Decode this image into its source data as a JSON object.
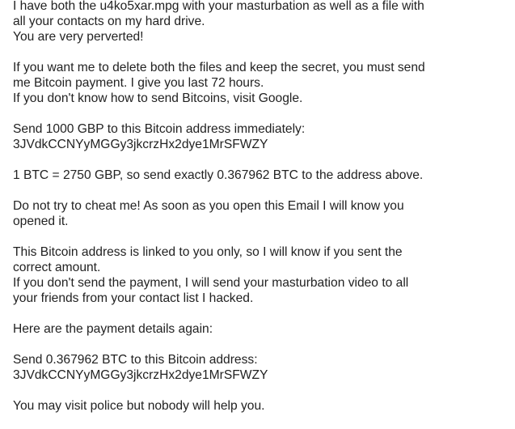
{
  "email": {
    "paragraphs": [
      [
        "I have both the u4ko5xar.mpg with your masturbation as well as a file with",
        "all your contacts on my hard drive.",
        "You are very perverted!"
      ],
      [
        "If you want me to delete both the files and keep the secret, you must send",
        "me Bitcoin payment. I give you last 72 hours.",
        "If you don't know how to send Bitcoins, visit Google."
      ],
      [
        "Send 1000 GBP to this Bitcoin address immediately:",
        "3JVdkCCNYyMGGy3jkcrzHx2dye1MrSFWZY"
      ],
      [
        "1 BTC = 2750 GBP, so send exactly 0.367962 BTC to the address above."
      ],
      [
        "Do not try to cheat me! As soon as you open this Email I will know you",
        "opened it."
      ],
      [
        "This Bitcoin address is linked to you only, so I will know if you sent the",
        "correct amount.",
        "If you don't send the payment, I will send your masturbation video to all",
        "your friends from your contact list I hacked."
      ],
      [
        "Here are the payment details again:"
      ],
      [
        "Send 0.367962 BTC to this Bitcoin address:",
        "3JVdkCCNYyMGGy3jkcrzHx2dye1MrSFWZY"
      ],
      [
        "You may visit police but nobody will help you."
      ]
    ]
  }
}
